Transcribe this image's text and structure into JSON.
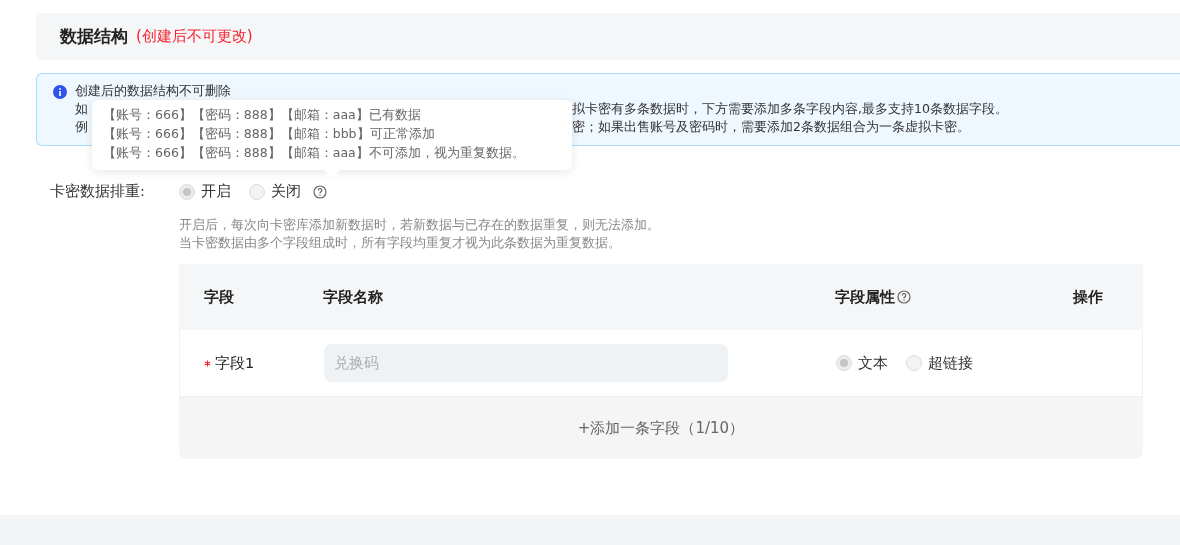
{
  "section": {
    "title": "数据结构",
    "note": "(创建后不可更改)"
  },
  "notice": {
    "line_1": "创建后的数据结构不可删除",
    "line_2": {
      "start": "如",
      "end": "拟卡密有多条数据时，下方需要添加多条字段内容,最多支持10条数据字段。"
    },
    "line_3": {
      "start": "例",
      "end": "密；如果出售账号及密码时，需要添加2条数据组合为一条虚拟卡密。"
    }
  },
  "tooltip": {
    "lines": [
      "【账号：666】【密码：888】【邮箱：aaa】已有数据",
      "【账号：666】【密码：888】【邮箱：bbb】可正常添加",
      "【账号：666】【密码：888】【邮箱：aaa】不可添加，视为重复数据。"
    ]
  },
  "dedupe": {
    "label": "卡密数据排重:",
    "options": [
      {
        "label": "开启",
        "selected": true
      },
      {
        "label": "关闭",
        "selected": false
      }
    ],
    "help": [
      "开启后，每次向卡密库添加新数据时，若新数据与已存在的数据重复，则无法添加。",
      "当卡密数据由多个字段组成时，所有字段均重复才视为此条数据为重复数据。"
    ]
  },
  "table": {
    "columns": [
      "字段",
      "字段名称",
      "字段属性",
      "操作"
    ],
    "rows": [
      {
        "field": "字段1",
        "required": true,
        "placeholder": "兑换码",
        "types": [
          {
            "label": "文本",
            "selected": true
          },
          {
            "label": "超链接",
            "selected": false
          }
        ]
      }
    ],
    "add_button": "+添加一条字段（1/10）"
  }
}
